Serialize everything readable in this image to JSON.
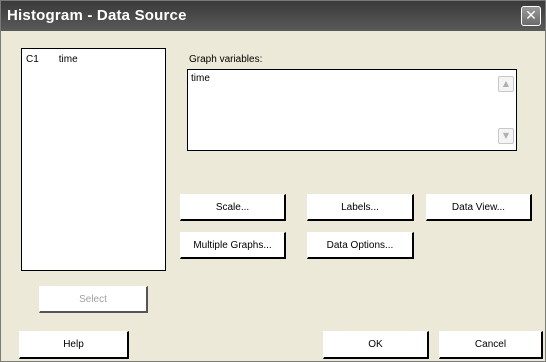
{
  "window": {
    "title": "Histogram - Data Source",
    "close_glyph": "✕"
  },
  "variables": {
    "items": [
      {
        "column": "C1",
        "name": "time"
      }
    ]
  },
  "graph_variables": {
    "label": "Graph variables:",
    "value": "time"
  },
  "buttons": {
    "scale": "Scale...",
    "labels": "Labels...",
    "data_view": "Data View...",
    "multiple_graphs": "Multiple Graphs...",
    "data_options": "Data Options...",
    "select": "Select",
    "help": "Help",
    "ok": "OK",
    "cancel": "Cancel"
  },
  "scroll": {
    "up_glyph": "▲",
    "down_glyph": "▼"
  }
}
